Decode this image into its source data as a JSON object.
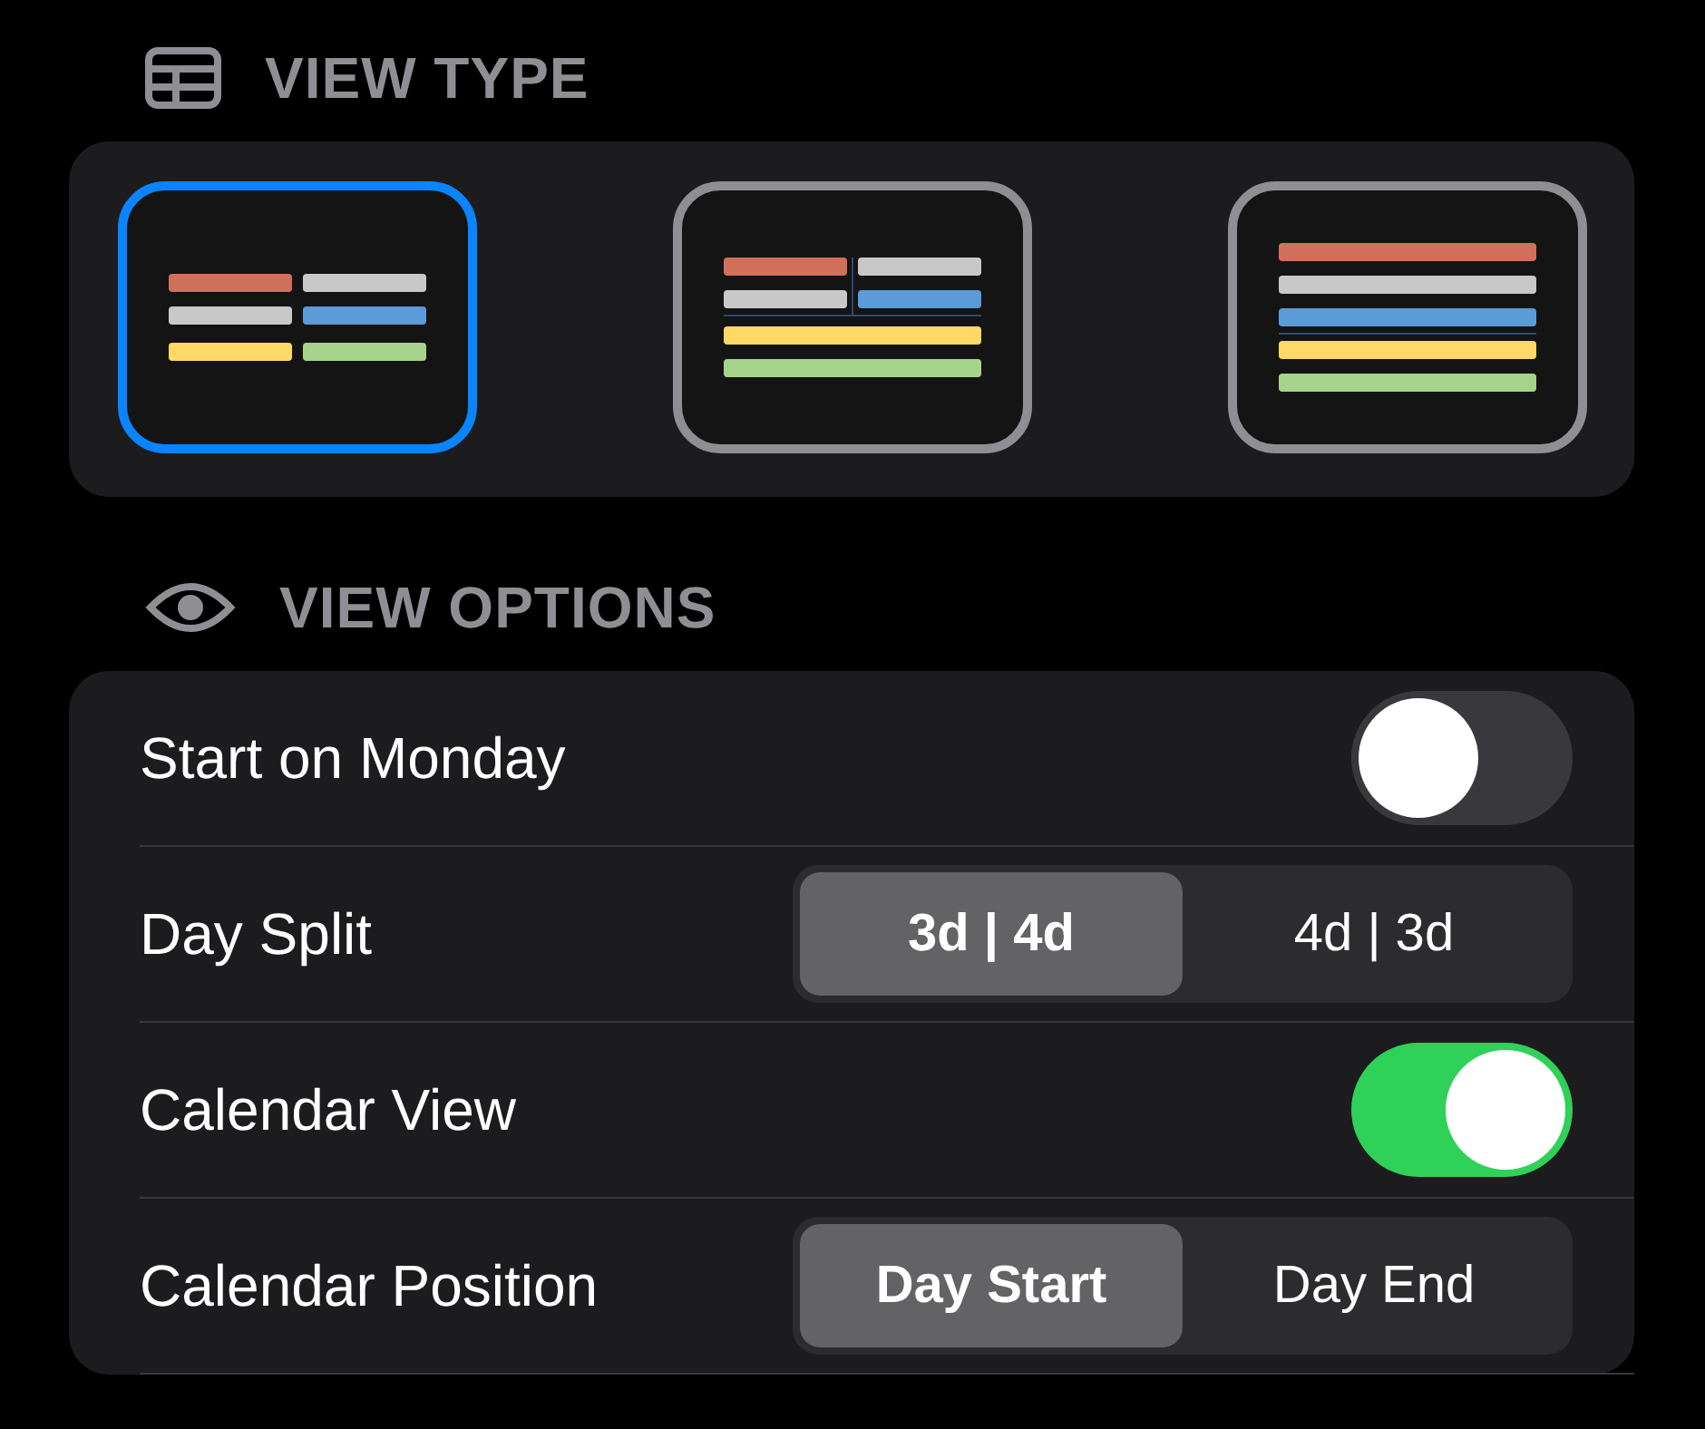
{
  "sections": [
    {
      "title": "VIEW TYPE",
      "options": [
        {
          "kind": "grid",
          "selected": true
        },
        {
          "kind": "mixed",
          "selected": false
        },
        {
          "kind": "list",
          "selected": false
        }
      ]
    },
    {
      "title": "VIEW OPTIONS",
      "rows": [
        {
          "kind": "toggle",
          "label": "Start on Monday",
          "on": false
        },
        {
          "kind": "segmented",
          "label": "Day Split",
          "segments": [
            {
              "label": "3d | 4d",
              "selected": true
            },
            {
              "label": "4d | 3d",
              "selected": false
            }
          ]
        },
        {
          "kind": "toggle",
          "label": "Calendar View",
          "on": true
        },
        {
          "kind": "segmented",
          "label": "Calendar Position",
          "segments": [
            {
              "label": "Day Start",
              "selected": true
            },
            {
              "label": "Day End",
              "selected": false
            }
          ]
        }
      ]
    }
  ]
}
